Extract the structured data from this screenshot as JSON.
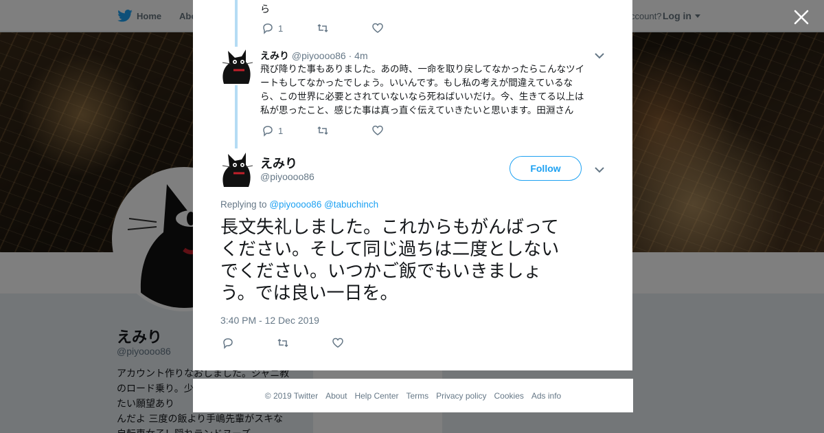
{
  "topbar": {
    "home_label": "Home",
    "about_label": "Abo",
    "account_prompt": "ccount?",
    "login_label": "Log in"
  },
  "profile": {
    "name": "えみり",
    "handle": "@piyoooo86",
    "bio_lines": [
      "アカウント作りなおしました。ジャニ教",
      "のロード乗り。少",
      "たい願望あり",
      "んだよ 三度の飯より手嶋先輩がスキな",
      "自転車女子！隠れランドヌーズ"
    ]
  },
  "thread": [
    {
      "text_tail": "ら",
      "reply_count": "1"
    },
    {
      "name": "えみり",
      "handle": "@piyoooo86",
      "time": "· 4m",
      "text_lines": [
        "飛び降りた事もありました。あの時、一命を取り戻してなかったらこんなツイ",
        "ートもしてなかったでしょう。いいんです。もし私の考えが間違えているな",
        "ら、この世界に必要とされていないなら死ねばいいだけ。今、生きてる以上は",
        "私が思ったこと、感じた事は真っ直ぐ伝えていきたいと思います。田淵さん"
      ],
      "reply_count": "1"
    }
  ],
  "main_tweet": {
    "name": "えみり",
    "handle": "@piyoooo86",
    "follow_label": "Follow",
    "replying_prefix": "Replying to",
    "replying_user1": "@piyoooo86",
    "replying_user2": "@tabuchinch",
    "text_lines": [
      "長文失礼しました。これからもがんばって",
      "ください。そして同じ過ちは二度としない",
      "でください。いつかご飯でもいきましょ",
      "う。では良い一日を。"
    ],
    "timestamp": "3:40 PM - 12 Dec 2019"
  },
  "footer": {
    "items": [
      "© 2019 Twitter",
      "About",
      "Help Center",
      "Terms",
      "Privacy policy",
      "Cookies",
      "Ads info"
    ]
  },
  "colors": {
    "twitter_blue": "#1da1f2",
    "thread_line": "#b5dcf4",
    "muted": "#657786"
  }
}
